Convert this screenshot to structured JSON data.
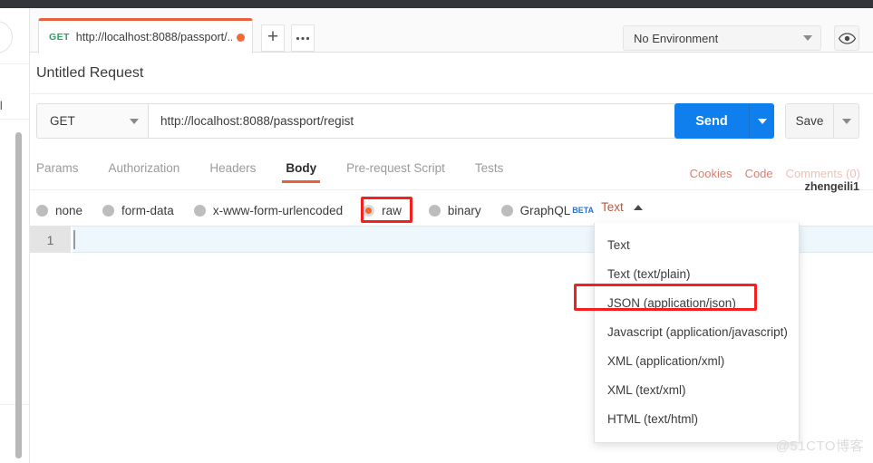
{
  "window": {
    "tab": {
      "method": "GET",
      "url_truncated": "http://localhost:8088/passport/...",
      "unsaved_indicator": "unsaved-dot"
    },
    "new_tab_label": "+",
    "tab_options_label": "•••"
  },
  "environment": {
    "selected": "No Environment",
    "eye_icon": "eye-icon",
    "gear_icon": "gear-icon"
  },
  "request": {
    "title": "Untitled Request",
    "method": "GET",
    "url": "http://localhost:8088/passport/regist",
    "send_label": "Send",
    "save_label": "Save"
  },
  "section_tabs": [
    {
      "label": "Params",
      "active": false
    },
    {
      "label": "Authorization",
      "active": false
    },
    {
      "label": "Headers",
      "active": false
    },
    {
      "label": "Body",
      "active": true
    },
    {
      "label": "Pre-request Script",
      "active": false
    },
    {
      "label": "Tests",
      "active": false
    }
  ],
  "right_links": {
    "cookies": "Cookies",
    "code": "Code",
    "comments": "Comments (0)",
    "user": "zhengeili1"
  },
  "body_types": [
    {
      "label": "none",
      "selected": false
    },
    {
      "label": "form-data",
      "selected": false
    },
    {
      "label": "x-www-form-urlencoded",
      "selected": false
    },
    {
      "label": "raw",
      "selected": true
    },
    {
      "label": "binary",
      "selected": false
    },
    {
      "label": "GraphQL",
      "selected": false,
      "badge": "BETA"
    }
  ],
  "content_type": {
    "selected": "Text",
    "expanded": true,
    "options": [
      "Text",
      "Text (text/plain)",
      "JSON (application/json)",
      "Javascript (application/javascript)",
      "XML (application/xml)",
      "XML (text/xml)",
      "HTML (text/html)"
    ],
    "highlighted_option": "JSON (application/json)"
  },
  "editor": {
    "line_number": "1",
    "content": ""
  },
  "sidebar": {
    "partial_text": "ll"
  },
  "watermark": "@51CTO博客",
  "colors": {
    "accent_orange": "#e8613c",
    "send_blue": "#0e7fec",
    "method_green": "#2f9e68",
    "annotation_red": "#f42020",
    "radio_selected": "#f4652b"
  }
}
